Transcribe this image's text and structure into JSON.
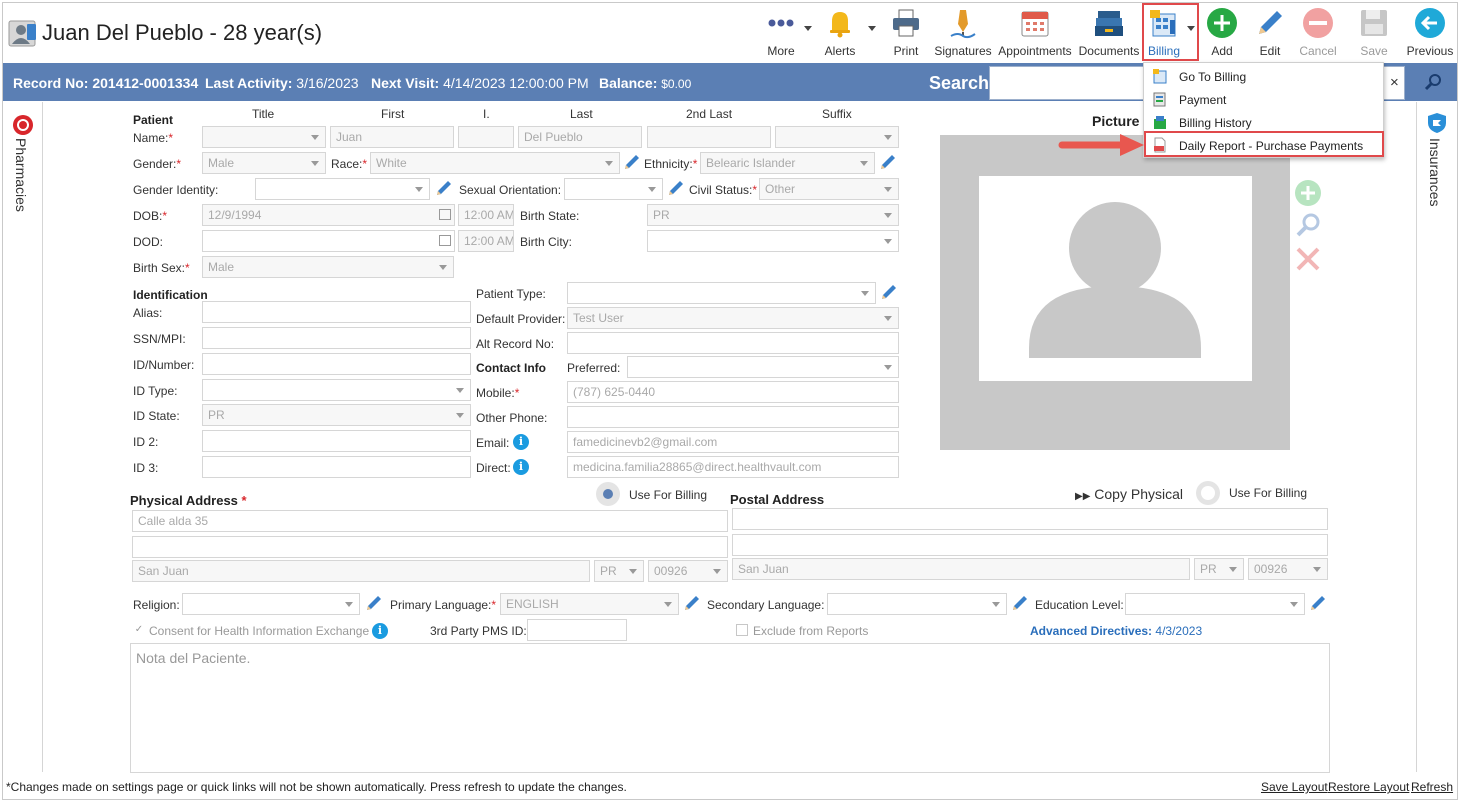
{
  "header": {
    "patient_name": "Juan Del Pueblo - 28 year(s)"
  },
  "toolbar": {
    "more": "More",
    "alerts": "Alerts",
    "print": "Print",
    "signatures": "Signatures",
    "appointments": "Appointments",
    "documents": "Documents",
    "billing": "Billing",
    "add": "Add",
    "edit": "Edit",
    "cancel": "Cancel",
    "save": "Save",
    "previous": "Previous"
  },
  "billing_menu": {
    "items": [
      {
        "label": "Go To Billing"
      },
      {
        "label": "Payment"
      },
      {
        "label": "Billing History"
      },
      {
        "label": "Daily Report - Purchase Payments"
      }
    ]
  },
  "infobar": {
    "record_label": "Record No:",
    "record_value": "201412-0001334",
    "last_activity_label": "Last Activity:",
    "last_activity_value": "3/16/2023",
    "next_visit_label": "Next Visit:",
    "next_visit_value": "4/14/2023 12:00:00 PM",
    "balance_label": "Balance:",
    "balance_value": "$0.00",
    "search_label": "Search:",
    "search_clear": "×"
  },
  "side": {
    "left": "Pharmacies",
    "right": "Insurances"
  },
  "patient": {
    "section": "Patient",
    "columns": [
      "Title",
      "First",
      "I.",
      "Last",
      "2nd Last",
      "Suffix"
    ],
    "name_label": "Name:",
    "first": "Juan",
    "last": "Del Pueblo",
    "gender_label": "Gender:",
    "gender": "Male",
    "race_label": "Race:",
    "race": "White",
    "ethnicity_label": "Ethnicity:",
    "ethnicity": "Belearic Islander",
    "gender_identity_label": "Gender Identity:",
    "sexual_orientation_label": "Sexual Orientation:",
    "civil_status_label": "Civil Status:",
    "civil_status": "Other",
    "dob_label": "DOB:",
    "dob": "12/9/1994",
    "dob_time": "12:00 AM",
    "birth_state_label": "Birth State:",
    "birth_state": "PR",
    "dod_label": "DOD:",
    "dod_time": "12:00 AM",
    "birth_city_label": "Birth City:",
    "birth_sex_label": "Birth Sex:",
    "birth_sex": "Male",
    "picture_label": "Picture"
  },
  "identification": {
    "section": "Identification",
    "alias_label": "Alias:",
    "ssn_label": "SSN/MPI:",
    "idnumber_label": "ID/Number:",
    "idtype_label": "ID Type:",
    "idstate_label": "ID State:",
    "idstate": "PR",
    "id2_label": "ID 2:",
    "id3_label": "ID 3:"
  },
  "contact": {
    "patient_type_label": "Patient Type:",
    "default_provider_label": "Default Provider:",
    "default_provider": "Test User",
    "alt_record_label": "Alt Record No:",
    "section": "Contact Info",
    "preferred_label": "Preferred:",
    "mobile_label": "Mobile:",
    "mobile": "(787) 625-0440",
    "other_phone_label": "Other Phone:",
    "email_label": "Email:",
    "email": "famedicinevb2@gmail.com",
    "direct_label": "Direct:",
    "direct": "medicina.familia28865@direct.healthvault.com"
  },
  "address": {
    "physical_section": "Physical Address",
    "use_for_billing": "Use For Billing",
    "postal_section": "Postal Address",
    "copy_physical": "Copy Physical",
    "use_for_billing_2": "Use For Billing",
    "physical_line1": "Calle alda 35",
    "physical_city": "San Juan",
    "physical_state": "PR",
    "physical_zip": "00926",
    "postal_city": "San Juan",
    "postal_state": "PR",
    "postal_zip": "00926"
  },
  "misc": {
    "religion_label": "Religion:",
    "primary_language_label": "Primary Language:",
    "primary_language": "ENGLISH",
    "secondary_language_label": "Secondary Language:",
    "education_label": "Education Level:",
    "consent_label": "Consent for Health Information Exchange",
    "third_party_label": "3rd Party PMS ID:",
    "exclude_label": "Exclude from Reports",
    "adv_directives_label": "Advanced Directives:",
    "adv_directives_value": "4/3/2023",
    "notes_placeholder": "Nota del Paciente."
  },
  "footer": {
    "note": "*Changes made on settings page or quick links will not be shown automatically. Press refresh to update the changes.",
    "save_layout": "Save Layout",
    "restore_layout": "Restore Layout",
    "refresh": "Refresh"
  },
  "colors": {
    "bar": "#5b7fb4",
    "highlight": "#e0494b",
    "link": "#2a6ebb",
    "required": "#d8262b"
  }
}
